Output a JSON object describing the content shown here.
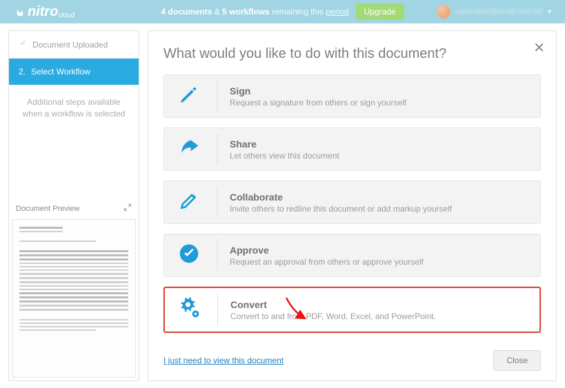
{
  "topbar": {
    "brand": "nitro",
    "brand_sub": "cloud",
    "quota_docs_num": "4",
    "quota_docs_word": "documents",
    "quota_amp": "&",
    "quota_wf_num": "5",
    "quota_wf_word": "workflows",
    "quota_remaining": "remaining this",
    "quota_period": "period",
    "upgrade": "Upgrade",
    "username": "username@email.host.tld"
  },
  "sidebar": {
    "step1_label": "Document Uploaded",
    "step2_num": "2.",
    "step2_label": "Select Workflow",
    "note": "Additional steps available when a workflow is selected",
    "preview_label": "Document Preview"
  },
  "content": {
    "title": "What would you like to do with this document?",
    "cards": [
      {
        "title": "Sign",
        "desc": "Request a signature from others or sign yourself"
      },
      {
        "title": "Share",
        "desc": "Let others view this document"
      },
      {
        "title": "Collaborate",
        "desc": "Invite others to redline this document or add markup yourself"
      },
      {
        "title": "Approve",
        "desc": "Request an approval from others or approve yourself"
      },
      {
        "title": "Convert",
        "desc": "Convert to and from PDF, Word, Excel, and PowerPoint."
      }
    ],
    "view_link": "I just need to view this document",
    "close": "Close"
  }
}
